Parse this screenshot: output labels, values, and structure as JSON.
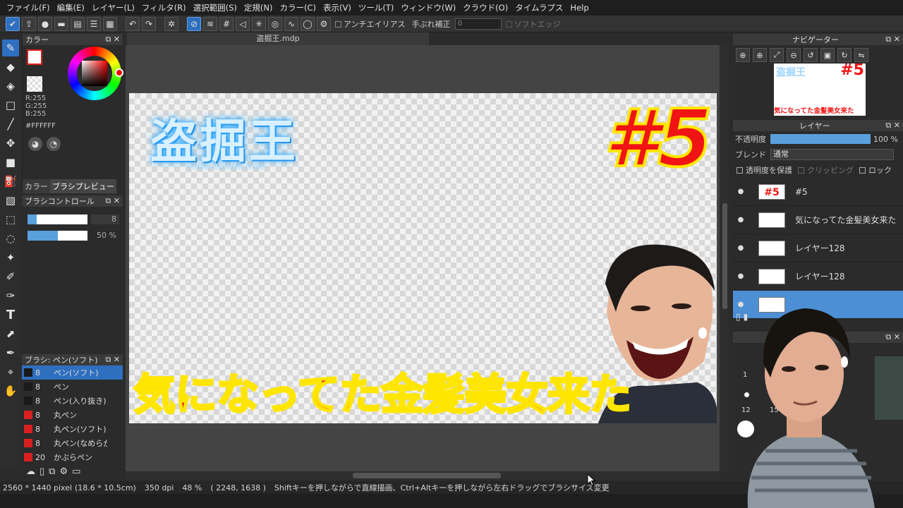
{
  "menu": [
    "ファイル(F)",
    "編集(E)",
    "レイヤー(L)",
    "フィルタ(R)",
    "選択範囲(S)",
    "定規(N)",
    "カラー(C)",
    "表示(V)",
    "ツール(T)",
    "ウィンドウ(W)",
    "クラウド(O)",
    "タイムラプス",
    "Help"
  ],
  "toolbar": {
    "antialias_label": "アンチエイリアス",
    "stabilizer_label": "手ぶれ補正",
    "stabilizer_value": "0",
    "soft_edge_label": "ソフトエッジ"
  },
  "color_panel": {
    "title": "カラー",
    "r": "R:255",
    "g": "G:255",
    "b": "B:255",
    "hex": "#FFFFFF",
    "tab_color": "カラー",
    "tab_preview": "ブラシプレビュー",
    "accent": "#2f6fbf"
  },
  "brush_control": {
    "title": "ブラシコントロール",
    "size": "8",
    "opacity": "50 %",
    "size_fraction": 0.15,
    "opacity_fraction": 0.5
  },
  "brush_list": {
    "title": "ブラシ: ペン(ソフト)",
    "items": [
      {
        "size": "8",
        "name": "ペン(ソフト)",
        "color": "#1a1a1a"
      },
      {
        "size": "8",
        "name": "ペン",
        "color": "#1a1a1a"
      },
      {
        "size": "8",
        "name": "ペン(入り抜き)",
        "color": "#1a1a1a"
      },
      {
        "size": "8",
        "name": "丸ペン",
        "color": "#d92020"
      },
      {
        "size": "8",
        "name": "丸ペン(ソフト)",
        "color": "#d92020"
      },
      {
        "size": "8",
        "name": "丸ペン(なめらか)",
        "color": "#d92020"
      },
      {
        "size": "20",
        "name": "かぶらペン",
        "color": "#d92020"
      }
    ]
  },
  "document": {
    "tab_title": "盗掘王.mdp",
    "logo_text": "盗掘王",
    "logo_sub": "TOMB RAIDER KING",
    "episode": "#5",
    "caption": "気になってた金髪美女来た"
  },
  "status": {
    "size": "2560 * 1440 pixel",
    "cm": "(18.6 * 10.5cm)",
    "dpi": "350 dpi",
    "zoom": "48 %",
    "coords": "( 2248, 1638 )",
    "hint": "Shiftキーを押しながらで直線描画、Ctrl+Altキーを押しながら左右ドラッグでブラシサイズ変更"
  },
  "navigator": {
    "title": "ナビゲーター",
    "thumb_logo": "盗掘王",
    "thumb_episode": "#5",
    "thumb_caption": "気になってた金髪美女来た"
  },
  "layers": {
    "title": "レイヤー",
    "opacity_label": "不透明度",
    "opacity_value": "100 %",
    "opacity_fraction": 1.0,
    "blend_label": "ブレンド",
    "blend_value": "通常",
    "protect_label": "透明度を保護",
    "clipping_label": "クリッピング",
    "lock_label": "ロック",
    "items": [
      {
        "name": "#5",
        "thumb": "#5"
      },
      {
        "name": "気になってた金髪美女来た",
        "thumb": ""
      },
      {
        "name": "レイヤー128",
        "thumb": ""
      },
      {
        "name": "レイヤー128",
        "thumb": ""
      },
      {
        "name": "",
        "thumb": ""
      }
    ]
  },
  "brush_size_panel": {
    "labels": [
      "1",
      "12",
      "15"
    ]
  }
}
